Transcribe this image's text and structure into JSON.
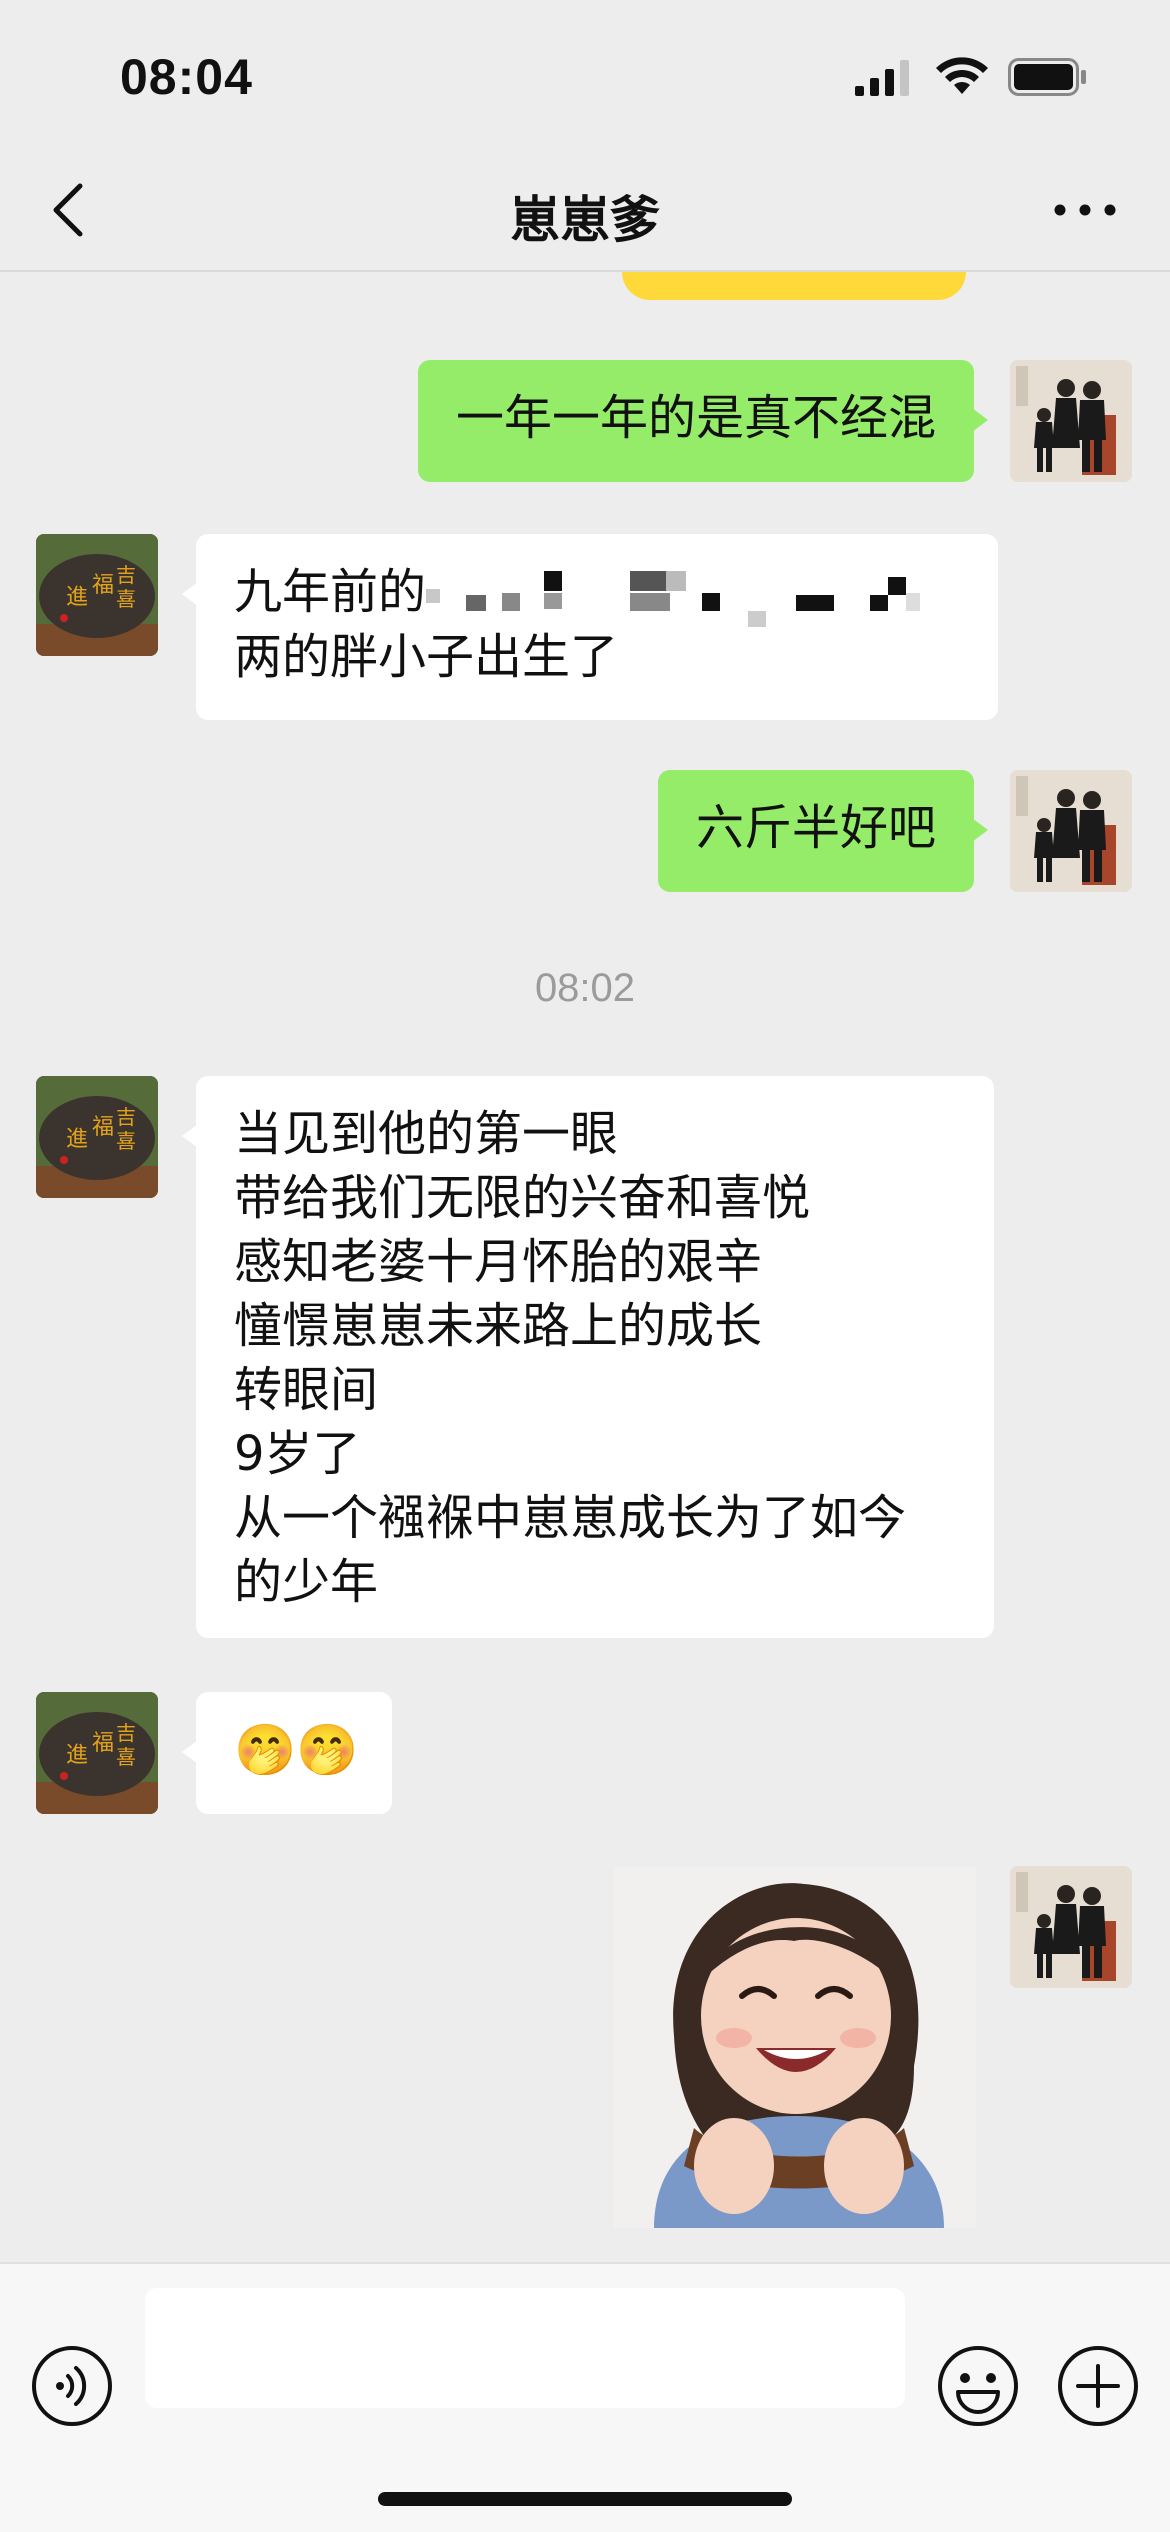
{
  "status_bar": {
    "time": "08:04"
  },
  "nav": {
    "title": "崽崽爹"
  },
  "messages": [
    {
      "side": "right",
      "type": "text",
      "lines": [
        "一年一年的是真不经混"
      ]
    },
    {
      "side": "left",
      "type": "text",
      "lines": [
        "九年前的",
        "两的胖小子出生了"
      ]
    },
    {
      "side": "right",
      "type": "text",
      "lines": [
        "六斤半好吧"
      ]
    },
    {
      "type": "timestamp",
      "text": "08:02"
    },
    {
      "side": "left",
      "type": "text",
      "lines": [
        "当见到他的第一眼",
        "带给我们无限的兴奋和喜悦",
        "感知老婆十月怀胎的艰辛",
        "憧憬崽崽未来路上的成长",
        "转眼间",
        "9岁了",
        "从一个襁褓中崽崽成长为了如今",
        "的少年"
      ]
    },
    {
      "side": "left",
      "type": "emoji",
      "text": "🤭🤭"
    },
    {
      "side": "right",
      "type": "image",
      "icon": "smiling-child-sticker"
    }
  ],
  "colors": {
    "background": "#ededed",
    "outgoing_bubble": "#95ec69",
    "incoming_bubble": "#ffffff",
    "timestamp": "#9b9b9b"
  }
}
